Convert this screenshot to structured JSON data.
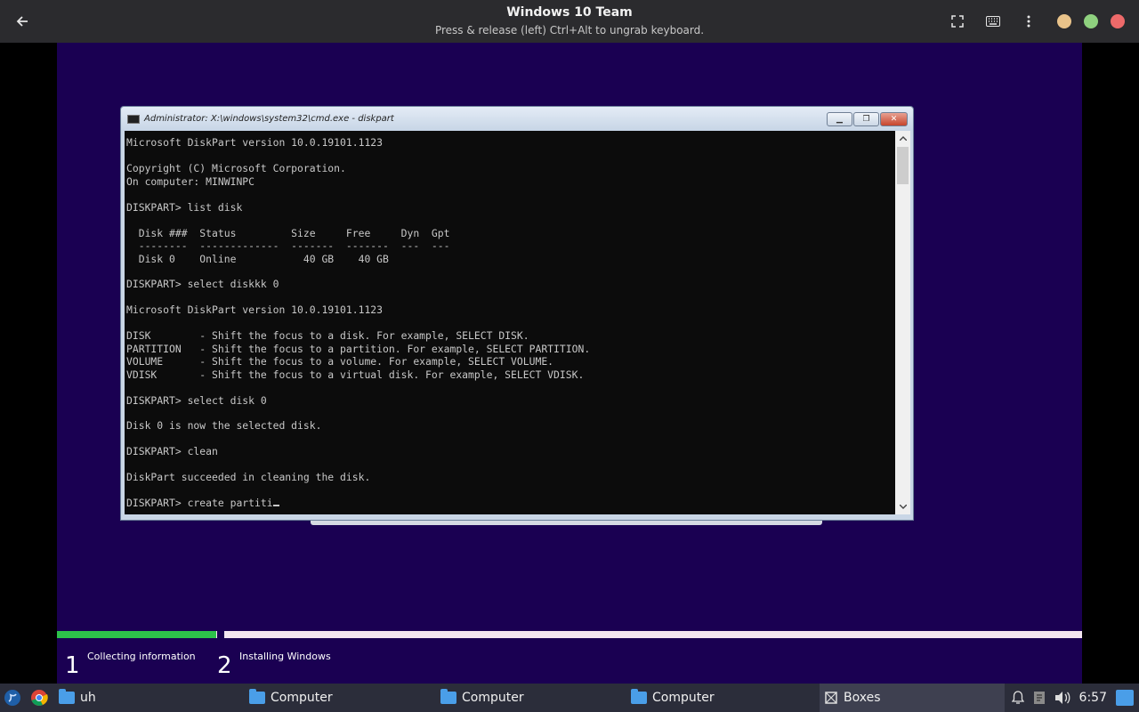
{
  "header": {
    "title": "Windows 10 Team",
    "subtitle": "Press & release (left) Ctrl+Alt to ungrab keyboard.",
    "back_icon": "arrow-left-icon",
    "tools": [
      "fullscreen-icon",
      "keyboard-icon",
      "menu-icon"
    ],
    "window_dots": [
      "#e9c38a",
      "#8fd17f",
      "#ee6a6a"
    ]
  },
  "cmd": {
    "title": "Administrator: X:\\windows\\system32\\cmd.exe - diskpart",
    "lines": [
      "",
      "Microsoft DiskPart version 10.0.19101.1123",
      "",
      "Copyright (C) Microsoft Corporation.",
      "On computer: MINWINPC",
      "",
      "DISKPART> list disk",
      "",
      "  Disk ###  Status         Size     Free     Dyn  Gpt",
      "  --------  -------------  -------  -------  ---  ---",
      "  Disk 0    Online           40 GB    40 GB",
      "",
      "DISKPART> select diskkk 0",
      "",
      "Microsoft DiskPart version 10.0.19101.1123",
      "",
      "DISK        - Shift the focus to a disk. For example, SELECT DISK.",
      "PARTITION   - Shift the focus to a partition. For example, SELECT PARTITION.",
      "VOLUME      - Shift the focus to a volume. For example, SELECT VOLUME.",
      "VDISK       - Shift the focus to a virtual disk. For example, SELECT VDISK.",
      "",
      "DISKPART> select disk 0",
      "",
      "Disk 0 is now the selected disk.",
      "",
      "DISKPART> clean",
      "",
      "DiskPart succeeded in cleaning the disk.",
      ""
    ],
    "current_input": "DISKPART> create partiti"
  },
  "setup": {
    "progress_percent": 15.5,
    "steps": [
      {
        "num": "1",
        "label": "Collecting information"
      },
      {
        "num": "2",
        "label": "Installing Windows"
      }
    ]
  },
  "taskbar": {
    "items": [
      {
        "label": "uh"
      },
      {
        "label": "Computer"
      },
      {
        "label": "Computer"
      },
      {
        "label": "Computer"
      },
      {
        "label": "Boxes"
      }
    ],
    "clock": "6:57"
  }
}
